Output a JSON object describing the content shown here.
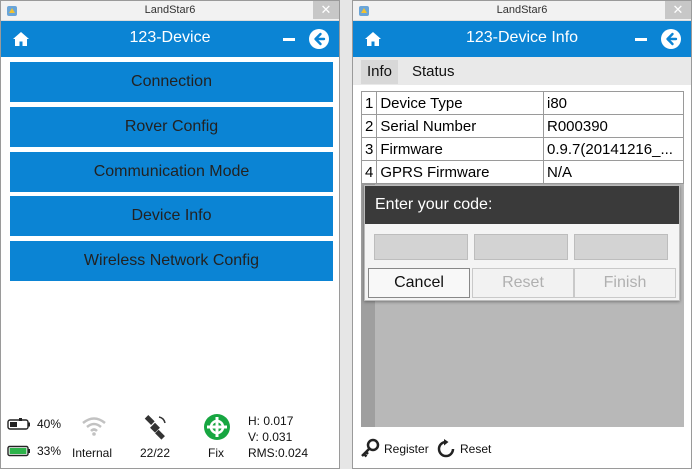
{
  "colors": {
    "accent": "#0b84d4",
    "fix_green": "#17a641",
    "battery_green": "#2db34a"
  },
  "left": {
    "window_title": "LandStar6",
    "app_title": "123-Device",
    "menu": [
      {
        "label": "Connection"
      },
      {
        "label": "Rover Config"
      },
      {
        "label": "Communication Mode"
      },
      {
        "label": "Device Info"
      },
      {
        "label": "Wireless Network Config"
      }
    ],
    "status": {
      "device_battery": "40%",
      "controller_battery": "33%",
      "link_label": "Internal",
      "satellites": "22/22",
      "solution": "Fix",
      "h": "H:  0.017",
      "v": "V:  0.031",
      "rms": "RMS:0.024"
    }
  },
  "right": {
    "window_title": "LandStar6",
    "app_title": "123-Device Info",
    "tabs": [
      {
        "label": "Info"
      },
      {
        "label": "Status"
      }
    ],
    "rows": [
      {
        "num": "1",
        "name": "Device Type",
        "value": "i80"
      },
      {
        "num": "2",
        "name": "Serial Number",
        "value": "R000390"
      },
      {
        "num": "3",
        "name": "Firmware",
        "value": "0.9.7(20141216_..."
      },
      {
        "num": "4",
        "name": "GPRS Firmware",
        "value": "N/A"
      }
    ],
    "dialog": {
      "title": "Enter your code:",
      "cancel": "Cancel",
      "reset": "Reset",
      "finish": "Finish"
    },
    "bottom": {
      "register": "Register",
      "reset": "Reset"
    }
  }
}
